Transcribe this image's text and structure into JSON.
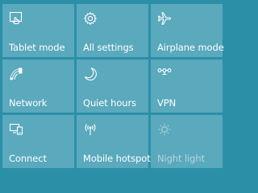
{
  "action_center": {
    "tiles": [
      {
        "label": "Tablet mode",
        "icon": "tablet-mode-icon",
        "enabled": true
      },
      {
        "label": "All settings",
        "icon": "gear-icon",
        "enabled": true
      },
      {
        "label": "Airplane mode",
        "icon": "airplane-icon",
        "enabled": true
      },
      {
        "label": "Network",
        "icon": "network-icon",
        "enabled": true
      },
      {
        "label": "Quiet hours",
        "icon": "moon-icon",
        "enabled": true
      },
      {
        "label": "VPN",
        "icon": "vpn-icon",
        "enabled": true
      },
      {
        "label": "Connect",
        "icon": "connect-icon",
        "enabled": true
      },
      {
        "label": "Mobile hotspot",
        "icon": "hotspot-icon",
        "enabled": true
      },
      {
        "label": "Night light",
        "icon": "night-light-icon",
        "enabled": false
      }
    ],
    "colors": {
      "background": "#2b8fa8",
      "tile": "#5aa9bd",
      "text": "#ffffff",
      "disabled_text": "#b6d6df"
    }
  }
}
